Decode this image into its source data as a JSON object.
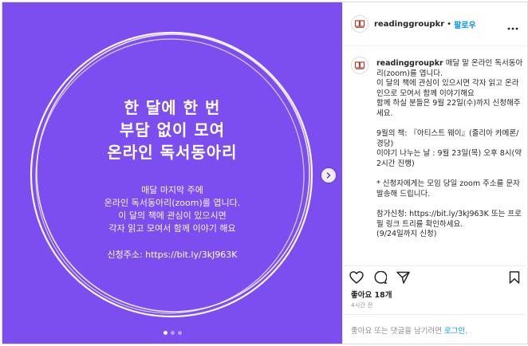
{
  "post": {
    "headline_lines": [
      "한 달에 한 번",
      "부담 없이 모여",
      "온라인 독서동아리"
    ],
    "body_lines": [
      "매달 마지막 주에",
      "온라인 독서동아리(zoom)를 엽니다.",
      "이 달의 책에 관심이 있으시면",
      "각자 읽고 모여서 함께 이야기 해요"
    ],
    "url_line": "신청주소: https://bit.ly/3kJ963K",
    "carousel_dots": 3,
    "active_dot": 0,
    "background_color": "#7c4ef0"
  },
  "header": {
    "username": "readinggroupkr",
    "separator": "•",
    "follow_label": "팔로우",
    "more_icon": "more-horizontal-icon"
  },
  "caption": {
    "username": "readinggroupkr",
    "text": "매달 말 온라인 독서동아리(zoom)를 엽니다.\n이 달의 책에 관심이 있으시면 각자 읽고 온라인으로 모여서 함께 이야기해요\n함께 하실 분들은 9월 22일(수)까지 신청해주세요.\n\n9월의 책: 『아티스트 웨이』(줄리아 카메론/경당)\n이야기 나누는 날 : 9월 23일(목) 오후 8시(약 2시간 진행)\n\n* 신청자에게는 모임 당일 zoom 주소를 문자 발송해 드립니다.\n\n참가신청: https://bit.ly/3kJ963K 또는 프로필 링크 트리를 확인하세요.\n(9/24일까지 신청)"
  },
  "actions": {
    "icons": [
      "heart-icon",
      "comment-icon",
      "share-icon",
      "bookmark-icon"
    ],
    "likes_text": "좋아요 18개",
    "time_text": "4시간 전"
  },
  "comment": {
    "prompt": "좋아요 또는 댓글을 남기려면",
    "login_label": "로그인."
  }
}
